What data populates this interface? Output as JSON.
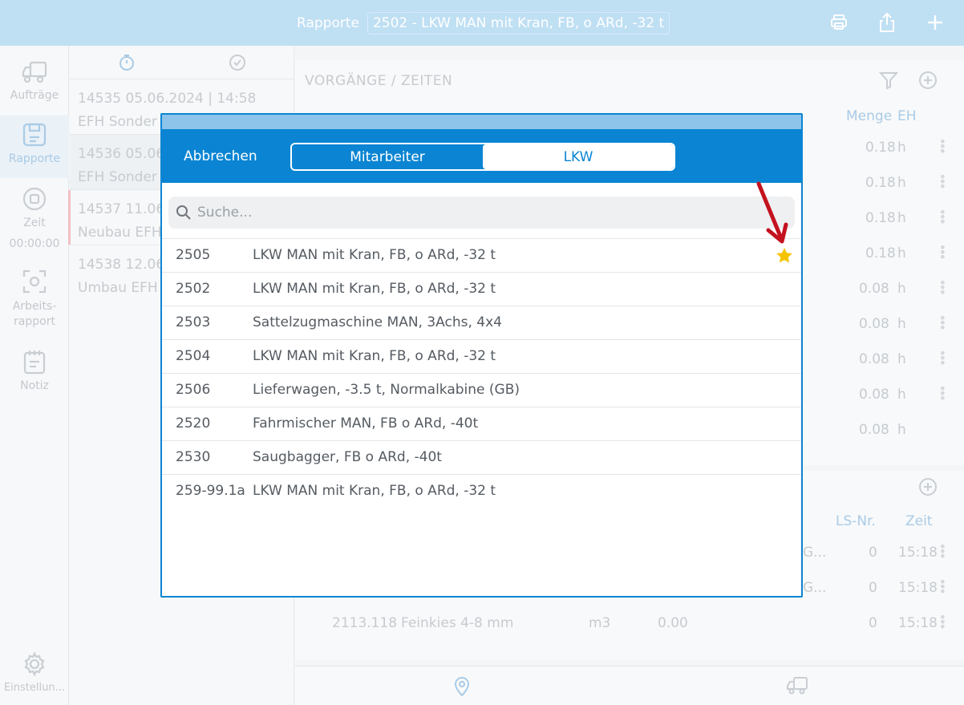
{
  "topbar": {
    "title": "Rapporte",
    "selected_vehicle": "2502 - LKW MAN mit Kran, FB, o ARd, -32 t",
    "icons": [
      "printer-icon",
      "share-icon",
      "plus-icon"
    ]
  },
  "sidebar": {
    "items": [
      {
        "label": "Aufträge",
        "icon": "truck-icon"
      },
      {
        "label": "Rapporte",
        "icon": "save-icon"
      },
      {
        "label": "Zeit",
        "icon": "stop-icon",
        "value": "00:00:00"
      },
      {
        "label": "Arbeits-\nrapport",
        "icon": "scan-icon"
      },
      {
        "label": "Notiz",
        "icon": "notepad-icon"
      },
      {
        "label": "Einstellun...",
        "icon": "gear-icon"
      }
    ]
  },
  "list": {
    "rows": [
      {
        "line1": "14535  05.06.2024 | 14:58",
        "line2": "EFH Sonder"
      },
      {
        "line1": "14536  05.06",
        "line2": "EFH Sonder"
      },
      {
        "line1": "14537  11.06.",
        "line2": "Neubau EFH"
      },
      {
        "line1": "14538  12.06",
        "line2": "Umbau EFH"
      }
    ]
  },
  "main": {
    "section_title": "VORGÄNGE / ZEITEN",
    "columns": {
      "menge": "Menge",
      "eh": "EH"
    },
    "rows": [
      {
        "value": "0.18",
        "unit": "h"
      },
      {
        "value": "0.18",
        "unit": "h"
      },
      {
        "value": "0.18",
        "unit": "h"
      },
      {
        "value": "0.18",
        "unit": "h"
      },
      {
        "value": "0.08",
        "unit": "h"
      },
      {
        "value": "0.08",
        "unit": "h"
      },
      {
        "value": "0.08",
        "unit": "h"
      },
      {
        "value": "0.08",
        "unit": "h"
      },
      {
        "value": "0.08",
        "unit": "h"
      }
    ],
    "material_columns": {
      "ls": "LS-Nr.",
      "zeit": "Zeit"
    },
    "material_rows": [
      {
        "code": "",
        "name": "",
        "tail": "G...",
        "unit": "",
        "qty": "",
        "ls": "0",
        "time": "15:18"
      },
      {
        "code": "",
        "name": "",
        "tail": "G...",
        "unit": "",
        "qty": "",
        "ls": "0",
        "time": "15:18"
      },
      {
        "code": "2113.118",
        "name": "Feinkies 4-8 mm",
        "tail": "",
        "unit": "m3",
        "qty": "0.00",
        "ls": "0",
        "time": "15:18"
      }
    ]
  },
  "modal": {
    "cancel": "Abbrechen",
    "tabs": {
      "mitarbeiter": "Mitarbeiter",
      "lkw": "LKW"
    },
    "search_placeholder": "Suche...",
    "vehicles": [
      {
        "num": "2505",
        "desc": "LKW MAN mit Kran, FB, o ARd, -32 t",
        "favorite": true
      },
      {
        "num": "2502",
        "desc": "LKW MAN mit Kran, FB, o ARd, -32 t"
      },
      {
        "num": "2503",
        "desc": "Sattelzugmaschine MAN, 3Achs, 4x4"
      },
      {
        "num": "2504",
        "desc": "LKW MAN mit Kran, FB, o ARd, -32 t"
      },
      {
        "num": "2506",
        "desc": "Lieferwagen, -3.5 t, Normalkabine (GB)"
      },
      {
        "num": "2520",
        "desc": "Fahrmischer MAN, FB o ARd, -40t"
      },
      {
        "num": "2530",
        "desc": "Saugbagger, FB o ARd, -40t"
      },
      {
        "num": "259-99.1a",
        "desc": "LKW MAN mit Kran, FB, o ARd, -32 t"
      }
    ]
  },
  "colors": {
    "accent": "#0b85d3",
    "topbar": "#bfdff3",
    "star": "#f5c400",
    "annotation_arrow": "#c4121f"
  }
}
